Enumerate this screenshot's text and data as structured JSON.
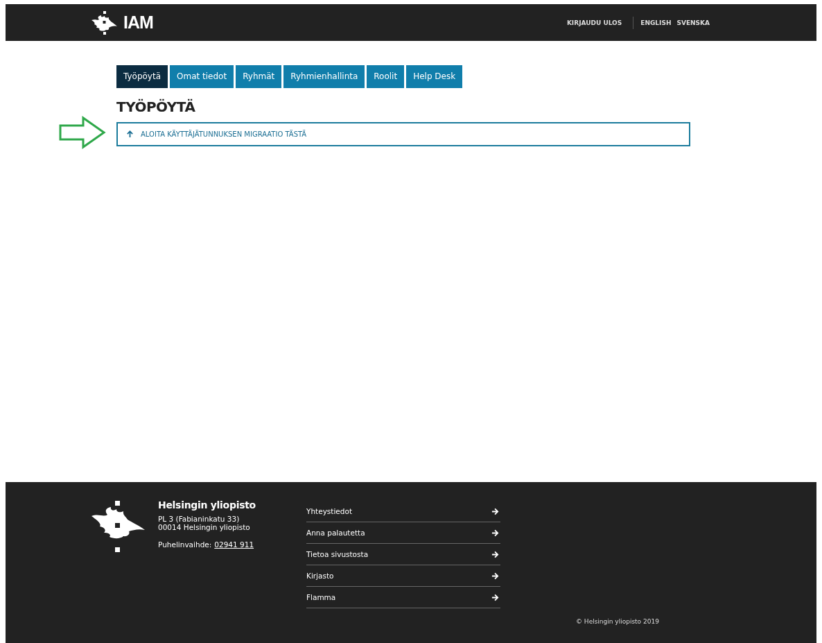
{
  "header": {
    "logo_text": "IAM",
    "links": [
      {
        "label": "KIRJAUDU ULOS",
        "kind": "action"
      },
      {
        "label": "ENGLISH",
        "kind": "language"
      },
      {
        "label": "SVENSKA",
        "kind": "language"
      }
    ]
  },
  "tabs": [
    {
      "label": "Työpöytä",
      "selected": true
    },
    {
      "label": "Omat tiedot",
      "selected": false
    },
    {
      "label": "Ryhmät",
      "selected": false
    },
    {
      "label": "Ryhmienhallinta",
      "selected": false
    },
    {
      "label": "Roolit",
      "selected": false
    },
    {
      "label": "Help Desk",
      "selected": false
    }
  ],
  "page_title": "TYÖPÖYTÄ",
  "migration_panel": {
    "label": "ALOITA KÄYTTÄJÄTUNNUKSEN MIGRAATIO TÄSTÄ",
    "expanded": false
  },
  "footer": {
    "name": "Helsingin yliopisto",
    "address": [
      "PL 3 (Fabianinkatu 33)",
      "00014 Helsingin yliopisto"
    ],
    "phone_label": "Puhelinvaihde:",
    "phone": "02941 911",
    "links": [
      "Yhteystiedot",
      "Anna palautetta",
      "Tietoa sivustosta",
      "Kirjasto",
      "Flamma"
    ],
    "copyright": "© Helsingin yliopisto 2019"
  }
}
